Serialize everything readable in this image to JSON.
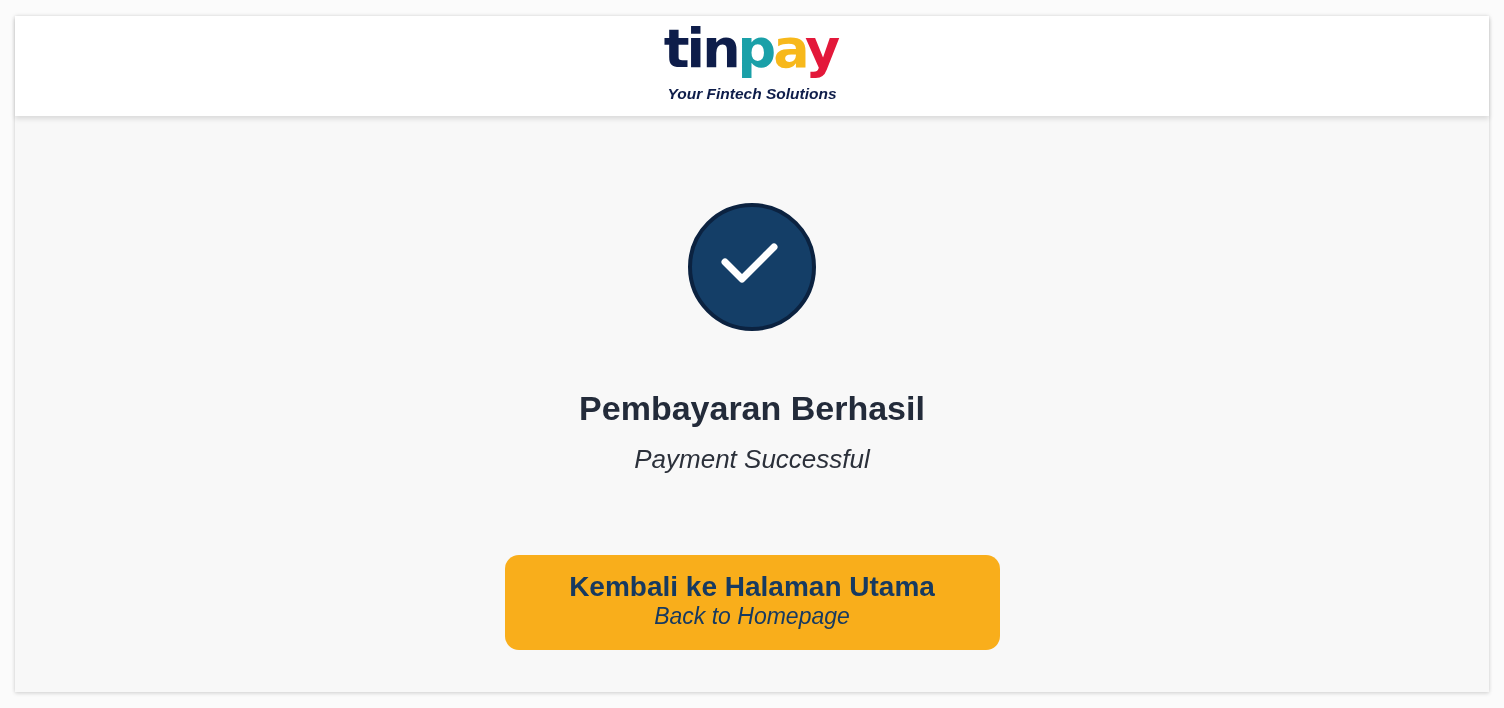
{
  "header": {
    "logo": {
      "wordmark": "tinpay",
      "tagline": "Your Fintech Solutions"
    }
  },
  "status": {
    "kind": "success",
    "title": "Pembayaran Berhasil",
    "subtitle": "Payment Successful"
  },
  "button": {
    "label": "Kembali ke Halaman Utama",
    "sublabel": "Back to Homepage"
  }
}
